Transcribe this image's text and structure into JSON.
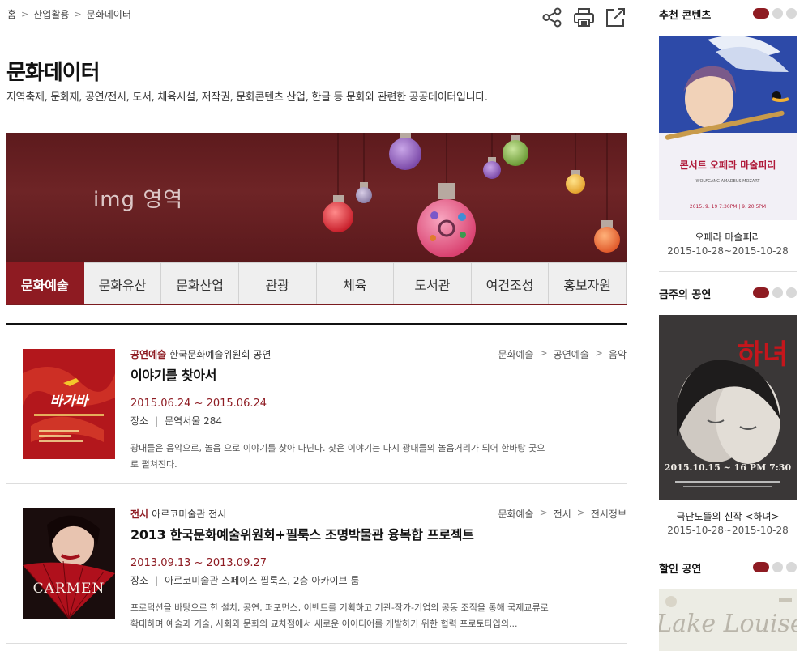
{
  "breadcrumb": {
    "home": "홈",
    "level1": "산업활용",
    "level2": "문화데이터",
    "sep": ">"
  },
  "tools": [
    "share-icon",
    "print-icon",
    "open-external-icon"
  ],
  "page": {
    "title": "문화데이터",
    "description": "지역축제, 문화재, 공연/전시, 도서, 체육시설, 저작권, 문화콘텐츠 산업, 한글 등 문화와 관련한 공공데이터입니다."
  },
  "banner": {
    "text": "img 영역"
  },
  "tabs": [
    {
      "label": "문화예술",
      "active": true
    },
    {
      "label": "문화유산",
      "active": false
    },
    {
      "label": "문화산업",
      "active": false
    },
    {
      "label": "관광",
      "active": false
    },
    {
      "label": "체육",
      "active": false
    },
    {
      "label": "도서관",
      "active": false
    },
    {
      "label": "여건조성",
      "active": false
    },
    {
      "label": "홍보자원",
      "active": false
    }
  ],
  "items": [
    {
      "category": "공연예술",
      "org": "한국문화예술위원회 공연",
      "path": [
        "문화예술",
        "공연예술",
        "음악"
      ],
      "title": "이야기를 찾아서",
      "date": "2015.06.24 ~ 2015.06.24",
      "place_label": "장소",
      "place": "문역서울 284",
      "desc": "광대들은 음악으로, 놀음 으로 이야기를 찾아 다닌다. 찾은 이야기는 다시 광대들의 놀음거리가 되어 한바탕 굿으로 펼쳐진다.",
      "poster_text": "바가바"
    },
    {
      "category": "전시",
      "org": "아르코미술관 전시",
      "path": [
        "문화예술",
        "전시",
        "전시정보"
      ],
      "title": "2013 한국문화예술위원회+필룩스 조명박물관 융복합 프로젝트",
      "date": "2013.09.13 ~ 2013.09.27",
      "place_label": "장소",
      "place": "아르코미술관 스페이스 필룩스, 2층 아카이브 룸",
      "desc": "프로덕션을 바탕으로 한 설치, 공연, 퍼포먼스, 이벤트를 기획하고 기관-작가-기업의 공동 조직을 통해 국제교류로 확대하며 예술과 기술, 사회와 문화의 교차점에서 새로운 아이디어를 개발하기 위한 협력 프로토타입의...",
      "poster_text": "CARMEN"
    }
  ],
  "sidebar": [
    {
      "title": "추천 콘텐츠",
      "caption": "오페라 마술피리",
      "date": "2015-10-28~2015-10-28",
      "poster_lines": [
        "콘서트 오페라 마술피리",
        "WOLFGANG AMADEUS MOZART",
        "2015. 9. 19 7:30PM | 9. 20 5PM"
      ]
    },
    {
      "title": "금주의 공연",
      "caption": "극단노뜰의 신작 <하녀>",
      "date": "2015-10-28~2015-10-28",
      "poster_lines": [
        "하녀",
        "2015.10.15 ~ 16 PM 7:30"
      ]
    },
    {
      "title": "할인 공연",
      "caption": "",
      "date": "",
      "poster_lines": [
        "Lake Louise"
      ]
    }
  ],
  "colors": {
    "accent": "#8e1b22",
    "banner": "#6a2225"
  }
}
